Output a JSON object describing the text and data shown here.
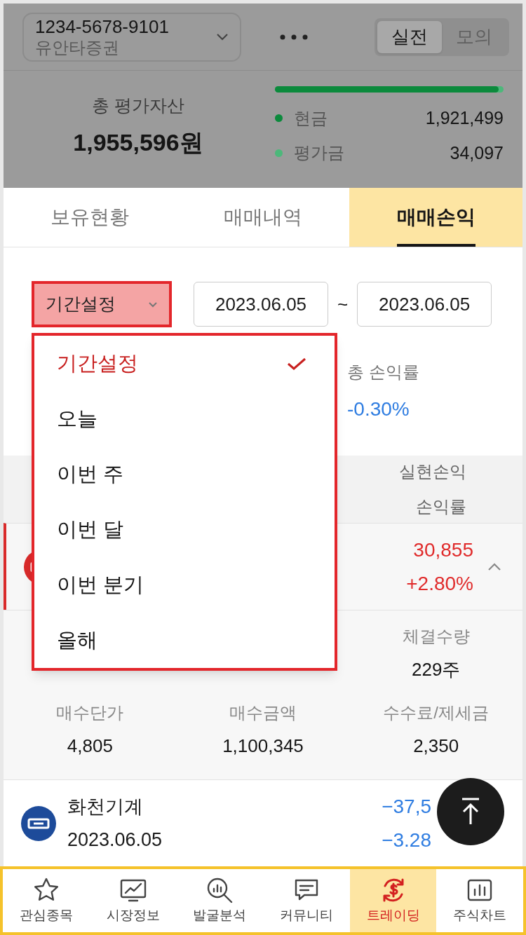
{
  "account": {
    "number": "1234-5678-9101",
    "broker": "유안타증권"
  },
  "mode_toggle": [
    {
      "label": "실전",
      "selected": true
    },
    {
      "label": "모의",
      "selected": false
    }
  ],
  "summary": {
    "label": "총 평가자산",
    "total": "1,955,596원",
    "level": 0.98,
    "items": [
      {
        "label": "현금",
        "value": "1,921,499",
        "color": "#0b8a3c"
      },
      {
        "label": "평가금",
        "value": "34,097",
        "color": "#4cb87a"
      }
    ]
  },
  "tabs": [
    {
      "label": "보유현황",
      "selected": false
    },
    {
      "label": "매매내역",
      "selected": false
    },
    {
      "label": "매매손익",
      "selected": true
    }
  ],
  "period_select": {
    "value": "기간설정",
    "expanded": true
  },
  "date_from": "2023.06.05",
  "separator": "~",
  "date_to": "2023.06.05",
  "dropdown_options": [
    {
      "label": "기간설정",
      "selected": true
    },
    {
      "label": "오늘",
      "selected": false
    },
    {
      "label": "이번 주",
      "selected": false
    },
    {
      "label": "이번 달",
      "selected": false
    },
    {
      "label": "이번 분기",
      "selected": false
    },
    {
      "label": "올해",
      "selected": false
    }
  ],
  "stats": [
    {
      "label": "총 손익률",
      "value": "-0.30%"
    }
  ],
  "table_header": [
    "실현손익",
    "손익률"
  ],
  "rows": [
    {
      "pnl": "30,855",
      "rate": "+2.80%",
      "color": "#d92b2b",
      "selected": true,
      "expanded": true,
      "details": [
        {
          "label": "체결수량",
          "value": "229주"
        },
        {
          "label": "매수단가",
          "value": "4,805"
        },
        {
          "label": "매수금액",
          "value": "1,100,345"
        },
        {
          "label": "수수료/제세금",
          "value": "2,350"
        }
      ]
    },
    {
      "name": "화천기계",
      "date": "2023.06.05",
      "pnl": "−37,5",
      "rate": "−3.28",
      "color": "#1d4b9a",
      "selected": false,
      "expanded": false
    }
  ],
  "nav": [
    {
      "label": "관심종목",
      "selected": false
    },
    {
      "label": "시장정보",
      "selected": false
    },
    {
      "label": "발굴분석",
      "selected": false
    },
    {
      "label": "커뮤니티",
      "selected": false
    },
    {
      "label": "트레이딩",
      "selected": true
    },
    {
      "label": "주식차트",
      "selected": false
    }
  ]
}
